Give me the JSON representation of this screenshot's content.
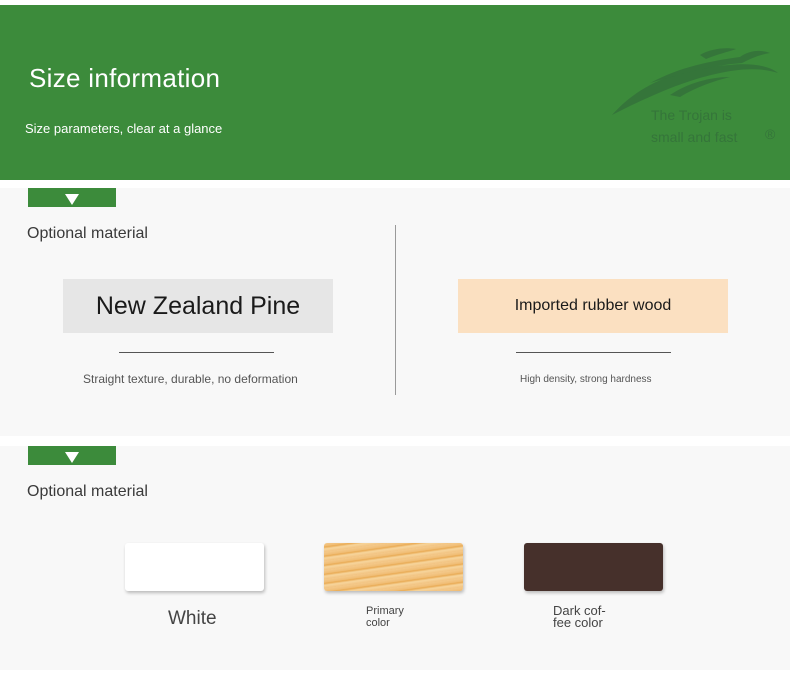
{
  "banner": {
    "title": "Size information",
    "subtitle": "Size parameters, clear at a glance",
    "logo_text_line1": "The Trojan is",
    "logo_text_line2": "small and fast",
    "logo_mark": "®",
    "color": "#3c8b3b"
  },
  "section1": {
    "label": "Optional material",
    "materials": [
      {
        "name": "New Zealand Pine",
        "description": "Straight texture, durable, no deformation",
        "box_color": "#e6e6e6"
      },
      {
        "name": "Imported rubber wood",
        "description": "High density, strong hardness",
        "box_color": "#fbe0c1"
      }
    ]
  },
  "section2": {
    "label": "Optional material",
    "colors": [
      {
        "label": "White",
        "swatch_color": "#ffffff"
      },
      {
        "label_line1": "Primary",
        "label_line2": "color",
        "swatch_color": "#f0bd75"
      },
      {
        "label_line1": "Dark cof-",
        "label_line2": "fee color",
        "swatch_color": "#46302b"
      }
    ]
  }
}
